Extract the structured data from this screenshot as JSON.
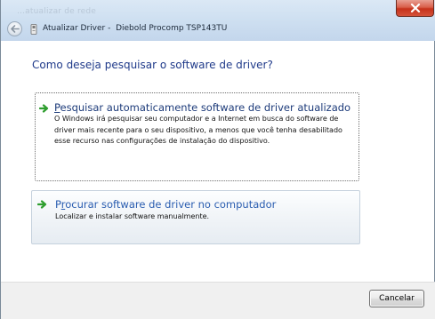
{
  "window": {
    "background_text": "...atualizar de rede",
    "title": "Atualizar Driver -  Diebold Procomp TSP143TU",
    "close_icon": "close-x-icon",
    "back_icon": "back-arrow-icon",
    "device_icon": "device-icon"
  },
  "content": {
    "heading": "Como deseja pesquisar o software de driver?",
    "options": [
      {
        "mnemonic": "P",
        "title_rest": "esquisar automaticamente software de driver atualizado",
        "description": "O Windows irá pesquisar seu computador e a Internet em busca do software de driver mais recente para o seu dispositivo, a menos que você tenha desabilitado esse recurso nas configurações de instalação do dispositivo.",
        "icon": "green-arrow-icon"
      },
      {
        "mnemonic": "r",
        "title_prefix": "P",
        "title_rest": "ocurar software de driver no computador",
        "description": "Localizar e instalar software manualmente.",
        "icon": "green-arrow-icon"
      }
    ]
  },
  "footer": {
    "cancel_label": "Cancelar"
  },
  "colors": {
    "heading": "#1f3a8a",
    "link_text": "#1d3b7a",
    "hover_link_text": "#2a5db0",
    "arrow_green": "#2f9e2f",
    "close_red": "#c6321b"
  }
}
